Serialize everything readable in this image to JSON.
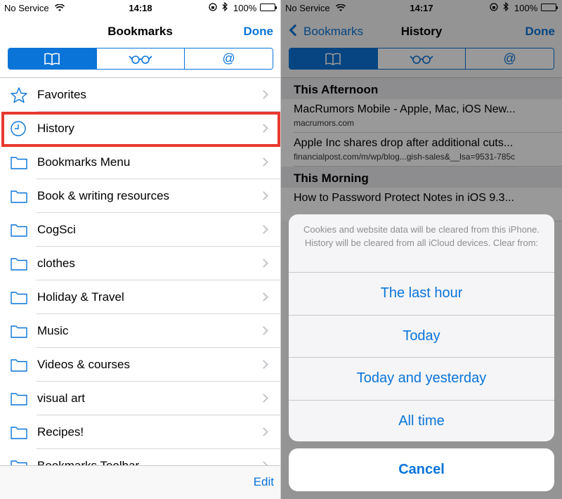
{
  "left_panel": {
    "status": {
      "carrier": "No Service",
      "time": "14:18",
      "battery": "100%"
    },
    "nav": {
      "title": "Bookmarks",
      "done": "Done"
    },
    "tabs": [
      "bookmarks-tab",
      "reading-list-tab",
      "shared-links-tab"
    ],
    "tab_at_glyph": "@",
    "items": [
      {
        "label": "Favorites",
        "icon": "star-icon"
      },
      {
        "label": "History",
        "icon": "clock-icon"
      },
      {
        "label": "Bookmarks Menu",
        "icon": "folder-icon"
      },
      {
        "label": "Book & writing resources",
        "icon": "folder-icon"
      },
      {
        "label": "CogSci",
        "icon": "folder-icon"
      },
      {
        "label": "clothes",
        "icon": "folder-icon"
      },
      {
        "label": "Holiday & Travel",
        "icon": "folder-icon"
      },
      {
        "label": "Music",
        "icon": "folder-icon"
      },
      {
        "label": "Videos & courses",
        "icon": "folder-icon"
      },
      {
        "label": "visual art",
        "icon": "folder-icon"
      },
      {
        "label": "Recipes!",
        "icon": "folder-icon"
      },
      {
        "label": "Bookmarks Toolbar",
        "icon": "folder-icon"
      }
    ],
    "toolbar": {
      "edit": "Edit"
    },
    "highlight_color": "#e8392e"
  },
  "right_panel": {
    "status": {
      "carrier": "No Service",
      "time": "14:17",
      "battery": "100%"
    },
    "nav": {
      "back": "Bookmarks",
      "title": "History",
      "done": "Done"
    },
    "tab_at_glyph": "@",
    "sections": [
      {
        "header": "This Afternoon",
        "items": [
          {
            "title": "MacRumors Mobile - Apple, Mac, iOS New...",
            "url": "macrumors.com"
          },
          {
            "title": "Apple Inc shares drop after additional cuts...",
            "url": "financialpost.com/m/wp/blog...gish-sales&__lsa=9531-785c"
          }
        ]
      },
      {
        "header": "This Morning",
        "items": [
          {
            "title": "How to Password Protect Notes in iOS 9.3...",
            "url": ""
          }
        ]
      }
    ],
    "sheet": {
      "message": "Cookies and website data will be cleared from this iPhone. History will be cleared from all iCloud devices. Clear from:",
      "options": [
        "The last hour",
        "Today",
        "Today and yesterday",
        "All time"
      ],
      "cancel": "Cancel"
    }
  },
  "colors": {
    "accent": "#0a74d8"
  }
}
